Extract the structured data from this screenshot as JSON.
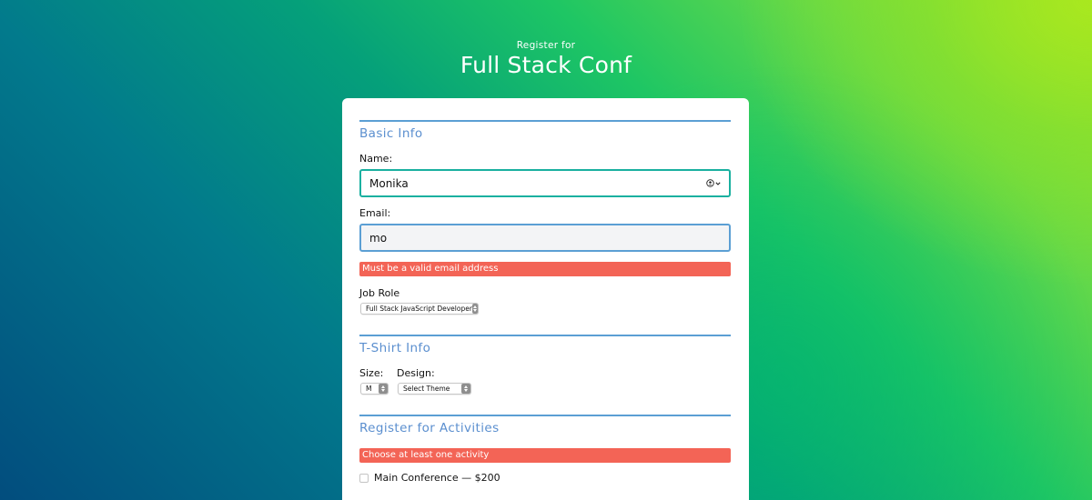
{
  "header": {
    "pretitle": "Register for",
    "title": "Full Stack Conf"
  },
  "basic_info": {
    "section_title": "Basic Info",
    "name_label": "Name:",
    "name_value": "Monika",
    "email_label": "Email:",
    "email_value": "mo",
    "email_error": "Must be a valid email address",
    "job_role_label": "Job Role",
    "job_role_selected": "Full Stack JavaScript Developer"
  },
  "tshirt_info": {
    "section_title": "T-Shirt Info",
    "size_label": "Size:",
    "size_selected": "M",
    "design_label": "Design:",
    "design_selected": "Select Theme"
  },
  "activities": {
    "section_title": "Register for Activities",
    "error": "Choose at least one activity",
    "items": [
      {
        "label": "Main Conference — $200",
        "checked": false
      }
    ]
  },
  "icons": {
    "autofill": "contact-autofill-icon",
    "select_arrows": "select-arrows-icon"
  },
  "colors": {
    "accent": "#5b9fd4",
    "section_title": "#5b8fcf",
    "error_bg": "#f36456",
    "name_focus_border": "#1ab0a0"
  }
}
